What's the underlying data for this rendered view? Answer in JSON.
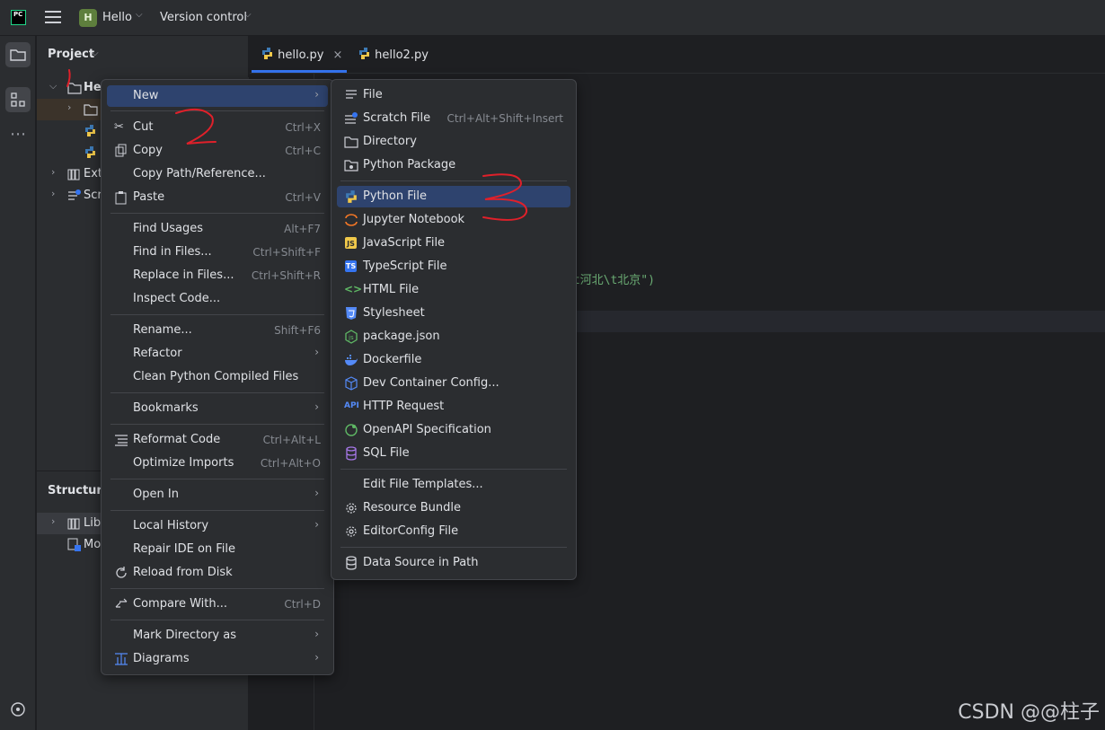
{
  "titlebar": {
    "logo": "PC",
    "project_badge": "H",
    "project_name": "Hello",
    "vcs": "Version control"
  },
  "panel": {
    "title": "Project",
    "structure_title": "Structure",
    "tree": [
      {
        "label": "He",
        "icon": "folder-icon",
        "expanded": true
      },
      {
        "label": "",
        "icon": "folder-icon"
      },
      {
        "label": "",
        "icon": "python-file-icon"
      },
      {
        "label": "",
        "icon": "python-file-icon"
      },
      {
        "label": "Ext",
        "icon": "library-icon"
      },
      {
        "label": "Scr",
        "icon": "scratches-icon"
      }
    ],
    "structure_tree": [
      {
        "label": "Lib",
        "icon": "library-icon"
      },
      {
        "label": "Mo",
        "icon": "module-icon"
      }
    ]
  },
  "editor": {
    "tabs": [
      {
        "label": "hello.py",
        "active": true
      },
      {
        "label": "hello2.py",
        "active": false
      }
    ],
    "code_visible": {
      "tail": "\\t河北\\t北京\")"
    }
  },
  "context_menu": {
    "items": [
      {
        "label": "New",
        "shortcut": "",
        "submenu": true,
        "selected": true
      },
      {
        "label": "Cut",
        "shortcut": "Ctrl+X",
        "icon": "scissors-icon"
      },
      {
        "label": "Copy",
        "shortcut": "Ctrl+C",
        "icon": "copy-icon"
      },
      {
        "label": "Copy Path/Reference...",
        "shortcut": ""
      },
      {
        "label": "Paste",
        "shortcut": "Ctrl+V",
        "icon": "paste-icon"
      },
      {
        "label": "Find Usages",
        "shortcut": "Alt+F7"
      },
      {
        "label": "Find in Files...",
        "shortcut": "Ctrl+Shift+F"
      },
      {
        "label": "Replace in Files...",
        "shortcut": "Ctrl+Shift+R"
      },
      {
        "label": "Inspect Code...",
        "shortcut": ""
      },
      {
        "label": "Rename...",
        "shortcut": "Shift+F6"
      },
      {
        "label": "Refactor",
        "submenu": true
      },
      {
        "label": "Clean Python Compiled Files",
        "shortcut": ""
      },
      {
        "label": "Bookmarks",
        "submenu": true
      },
      {
        "label": "Reformat Code",
        "shortcut": "Ctrl+Alt+L",
        "icon": "reformat-icon"
      },
      {
        "label": "Optimize Imports",
        "shortcut": "Ctrl+Alt+O"
      },
      {
        "label": "Open In",
        "submenu": true
      },
      {
        "label": "Local History",
        "submenu": true
      },
      {
        "label": "Repair IDE on File",
        "shortcut": ""
      },
      {
        "label": "Reload from Disk",
        "shortcut": "",
        "icon": "reload-icon"
      },
      {
        "label": "Compare With...",
        "shortcut": "Ctrl+D",
        "icon": "compare-icon"
      },
      {
        "label": "Mark Directory as",
        "submenu": true
      },
      {
        "label": "Diagrams",
        "submenu": true,
        "icon": "diagram-icon"
      }
    ]
  },
  "new_submenu": {
    "items": [
      {
        "label": "File",
        "icon": "file-icon"
      },
      {
        "label": "Scratch File",
        "shortcut": "Ctrl+Alt+Shift+Insert",
        "icon": "scratch-file-icon"
      },
      {
        "label": "Directory",
        "icon": "folder-icon"
      },
      {
        "label": "Python Package",
        "icon": "package-icon"
      },
      {
        "label": "Python File",
        "icon": "python-icon",
        "selected": true
      },
      {
        "label": "Jupyter Notebook",
        "icon": "jupyter-icon"
      },
      {
        "label": "JavaScript File",
        "icon": "javascript-icon"
      },
      {
        "label": "TypeScript File",
        "icon": "typescript-icon"
      },
      {
        "label": "HTML File",
        "icon": "html-icon"
      },
      {
        "label": "Stylesheet",
        "icon": "css-icon"
      },
      {
        "label": "package.json",
        "icon": "nodejs-icon"
      },
      {
        "label": "Dockerfile",
        "icon": "docker-icon"
      },
      {
        "label": "Dev Container Config...",
        "icon": "cube-icon"
      },
      {
        "label": "HTTP Request",
        "icon": "api-icon"
      },
      {
        "label": "OpenAPI Specification",
        "icon": "openapi-icon"
      },
      {
        "label": "SQL File",
        "icon": "database-icon"
      },
      {
        "label": "Edit File Templates...",
        "icon": ""
      },
      {
        "label": "Resource Bundle",
        "icon": "gear-icon"
      },
      {
        "label": "EditorConfig File",
        "icon": "gear-icon"
      },
      {
        "label": "Data Source in Path",
        "icon": "database-icon"
      }
    ]
  },
  "annotations": [
    "1",
    "2",
    "3"
  ],
  "watermark": "CSDN @@柱子",
  "colors": {
    "accent": "#3574f0",
    "selection": "#2e436e",
    "annotation": "#e0202a"
  }
}
